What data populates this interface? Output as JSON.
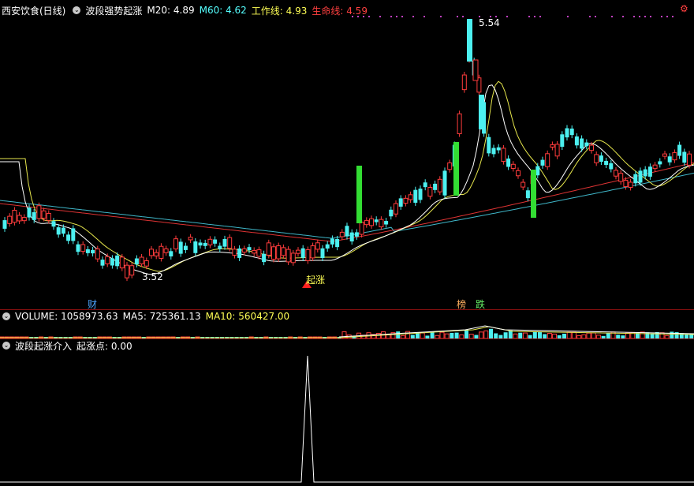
{
  "header": {
    "stock_name": "西安饮食(日线)",
    "indicator_name": "波段强势起涨",
    "ma20": "M20: 4.89",
    "ma60": "M60: 4.62",
    "work_line": "工作线: 4.93",
    "life_line": "生命线: 4.59"
  },
  "price_panel": {
    "high_label": "5.54",
    "low_label": "3.52",
    "signal_label": "起涨",
    "bottom_markers": [
      "财",
      "榜",
      "跌"
    ]
  },
  "volume_panel": {
    "volume": "VOLUME: 1058973.63",
    "ma5": "MA5: 725361.13",
    "ma10": "MA10: 560427.00"
  },
  "indicator_panel": {
    "title": "波段起涨介入",
    "value": "起涨点: 0.00"
  },
  "colors": {
    "up": "#ff3c3c",
    "down": "#4cf0f0",
    "signal": "#33dd33",
    "ma_white": "#ffffff",
    "ma_yellow": "#e6e64c",
    "ma_red": "#dd3333",
    "ma_cyan": "#3fb6c8"
  }
}
